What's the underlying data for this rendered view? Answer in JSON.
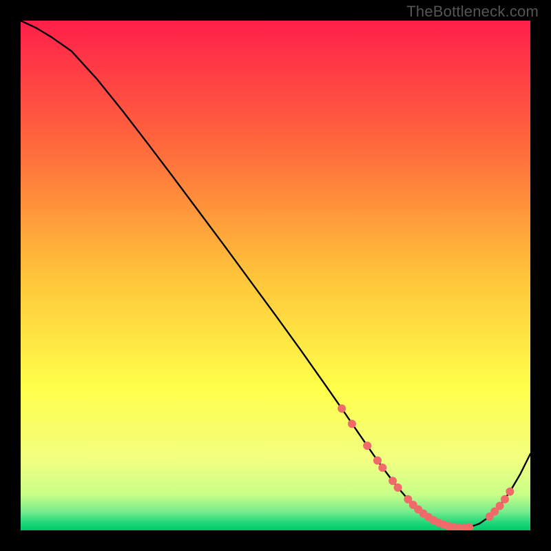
{
  "watermark": "TheBottleneck.com",
  "colors": {
    "frame": "#000000",
    "line": "#000000",
    "marker": "#f06a6a",
    "watermark_text": "#555555"
  },
  "chart_data": {
    "type": "line",
    "title": "",
    "xlabel": "",
    "ylabel": "",
    "xlim": [
      0,
      100
    ],
    "ylim": [
      0,
      100
    ],
    "gradient_stops": [
      {
        "offset": 0.0,
        "color": "#ff1f4a"
      },
      {
        "offset": 0.25,
        "color": "#ff6a3c"
      },
      {
        "offset": 0.5,
        "color": "#ffc43a"
      },
      {
        "offset": 0.72,
        "color": "#ffff4a"
      },
      {
        "offset": 0.86,
        "color": "#f3ff80"
      },
      {
        "offset": 0.93,
        "color": "#c8ff88"
      },
      {
        "offset": 0.965,
        "color": "#72eb8c"
      },
      {
        "offset": 0.985,
        "color": "#1fd87a"
      },
      {
        "offset": 1.0,
        "color": "#00c96a"
      }
    ],
    "series": [
      {
        "name": "bottleneck-curve",
        "x": [
          0,
          3,
          6,
          10,
          15,
          20,
          25,
          30,
          35,
          40,
          45,
          50,
          55,
          60,
          63,
          66,
          68,
          70,
          72,
          74,
          76,
          78,
          80,
          82,
          84,
          86,
          88,
          90,
          92,
          94,
          96,
          98,
          100
        ],
        "y": [
          100,
          98.6,
          96.8,
          94,
          88.5,
          82.3,
          75.8,
          69.2,
          62.5,
          55.8,
          49.0,
          42.2,
          35.3,
          28.2,
          23.9,
          19.5,
          16.6,
          13.7,
          11.0,
          8.4,
          6.1,
          4.1,
          2.6,
          1.5,
          0.8,
          0.5,
          0.6,
          1.3,
          2.7,
          4.8,
          7.6,
          11.0,
          15.0
        ]
      }
    ],
    "markers": [
      {
        "x": 63,
        "y": 23.9
      },
      {
        "x": 65,
        "y": 20.9
      },
      {
        "x": 68,
        "y": 16.6
      },
      {
        "x": 70,
        "y": 13.7
      },
      {
        "x": 71,
        "y": 12.3
      },
      {
        "x": 73,
        "y": 9.7
      },
      {
        "x": 74,
        "y": 8.4
      },
      {
        "x": 76,
        "y": 6.1
      },
      {
        "x": 77,
        "y": 5.0
      },
      {
        "x": 78,
        "y": 4.1
      },
      {
        "x": 79,
        "y": 3.3
      },
      {
        "x": 80,
        "y": 2.6
      },
      {
        "x": 81,
        "y": 2.0
      },
      {
        "x": 82,
        "y": 1.5
      },
      {
        "x": 83,
        "y": 1.1
      },
      {
        "x": 84,
        "y": 0.8
      },
      {
        "x": 85,
        "y": 0.6
      },
      {
        "x": 86,
        "y": 0.5
      },
      {
        "x": 87,
        "y": 0.5
      },
      {
        "x": 88,
        "y": 0.6
      },
      {
        "x": 92,
        "y": 2.7
      },
      {
        "x": 93,
        "y": 3.7
      },
      {
        "x": 94,
        "y": 4.8
      },
      {
        "x": 95,
        "y": 6.1
      },
      {
        "x": 96,
        "y": 7.6
      }
    ]
  }
}
